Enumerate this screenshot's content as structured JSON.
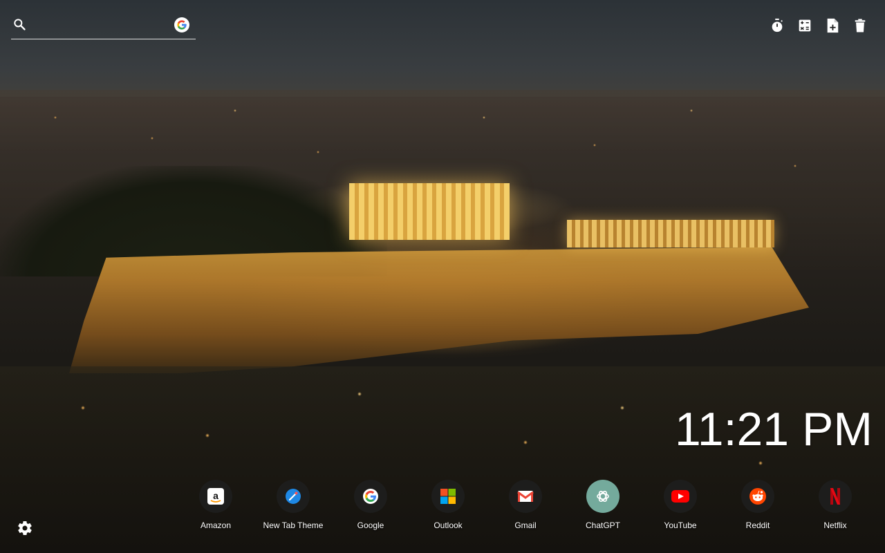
{
  "search": {
    "placeholder": "",
    "value": "",
    "engine_icon": "google-g-icon"
  },
  "toolbar": {
    "items": [
      {
        "name": "timer",
        "icon": "stopwatch-icon"
      },
      {
        "name": "calculator",
        "icon": "calculator-icon"
      },
      {
        "name": "new-note",
        "icon": "note-add-icon"
      },
      {
        "name": "trash",
        "icon": "trash-icon"
      }
    ]
  },
  "clock": {
    "time": "11:21 PM"
  },
  "shortcuts": [
    {
      "label": "Amazon",
      "icon": "amazon-icon"
    },
    {
      "label": "New Tab Theme",
      "icon": "new-tab-theme-icon"
    },
    {
      "label": "Google",
      "icon": "google-icon"
    },
    {
      "label": "Outlook",
      "icon": "outlook-icon"
    },
    {
      "label": "Gmail",
      "icon": "gmail-icon"
    },
    {
      "label": "ChatGPT",
      "icon": "chatgpt-icon"
    },
    {
      "label": "YouTube",
      "icon": "youtube-icon"
    },
    {
      "label": "Reddit",
      "icon": "reddit-icon"
    },
    {
      "label": "Netflix",
      "icon": "netflix-icon"
    }
  ],
  "settings": {
    "icon": "gear-icon"
  },
  "colors": {
    "text": "#ffffff",
    "shortcut_bg": "#1e1e1e",
    "youtube": "#ff0000",
    "netflix": "#e50914",
    "reddit": "#ff4500",
    "google_blue": "#4285f4",
    "google_red": "#ea4335",
    "google_yellow": "#fbbc05",
    "google_green": "#34a853"
  }
}
